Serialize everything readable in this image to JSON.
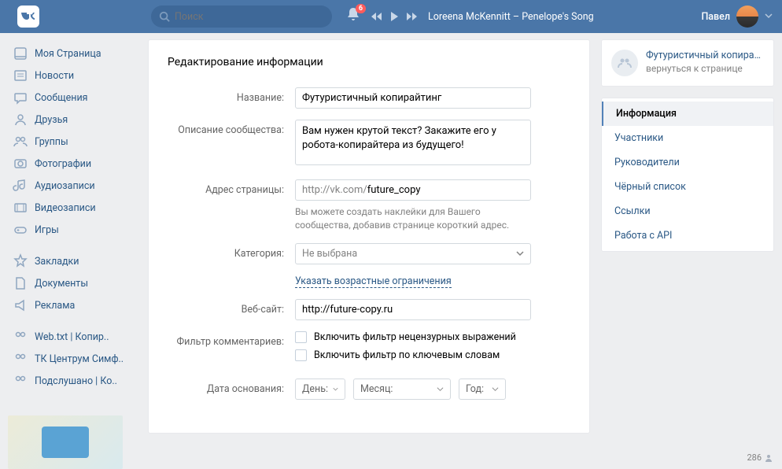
{
  "header": {
    "search_placeholder": "Поиск",
    "notif_count": "6",
    "song": "Loreena McKennitt – Penelope's Song",
    "username": "Павел"
  },
  "sidebar": {
    "items": [
      {
        "label": "Моя Страница"
      },
      {
        "label": "Новости"
      },
      {
        "label": "Сообщения"
      },
      {
        "label": "Друзья"
      },
      {
        "label": "Группы"
      },
      {
        "label": "Фотографии"
      },
      {
        "label": "Аудиозаписи"
      },
      {
        "label": "Видеозаписи"
      },
      {
        "label": "Игры"
      }
    ],
    "secondary": [
      {
        "label": "Закладки"
      },
      {
        "label": "Документы"
      },
      {
        "label": "Реклама"
      }
    ],
    "groups": [
      {
        "label": "Web.txt | Копир.."
      },
      {
        "label": "ТК Центрум Симф.."
      },
      {
        "label": "Подслушано | Ко.."
      }
    ]
  },
  "form": {
    "title": "Редактирование информации",
    "name_label": "Название:",
    "name_value": "Футуристичный копирайтинг",
    "desc_label": "Описание сообщества:",
    "desc_value": "Вам нужен крутой текст? Закажите его у робота-копирайтера из будущего!",
    "url_label": "Адрес страницы:",
    "url_prefix": "http://vk.com/",
    "url_value": "future_copy",
    "url_hint": "Вы можете создать наклейки для Вашего сообщества, добавив странице короткий адрес.",
    "cat_label": "Категория:",
    "cat_value": "Не выбрана",
    "age_link": "Указать возрастные ограничения",
    "site_label": "Веб-сайт:",
    "site_value": "http://future-copy.ru",
    "filter_label": "Фильтр комментариев:",
    "filter1": "Включить фильтр нецензурных выражений",
    "filter2": "Включить фильтр по ключевым словам",
    "date_label": "Дата основания:",
    "day": "День:",
    "month": "Месяц:",
    "year": "Год:"
  },
  "right": {
    "group_name": "Футуристичный копирай...",
    "back": "вернуться к странице",
    "tabs": [
      {
        "label": "Информация",
        "active": true
      },
      {
        "label": "Участники"
      },
      {
        "label": "Руководители"
      },
      {
        "label": "Чёрный список"
      },
      {
        "label": "Ссылки"
      },
      {
        "label": "Работа с API"
      }
    ]
  },
  "counter": "286"
}
